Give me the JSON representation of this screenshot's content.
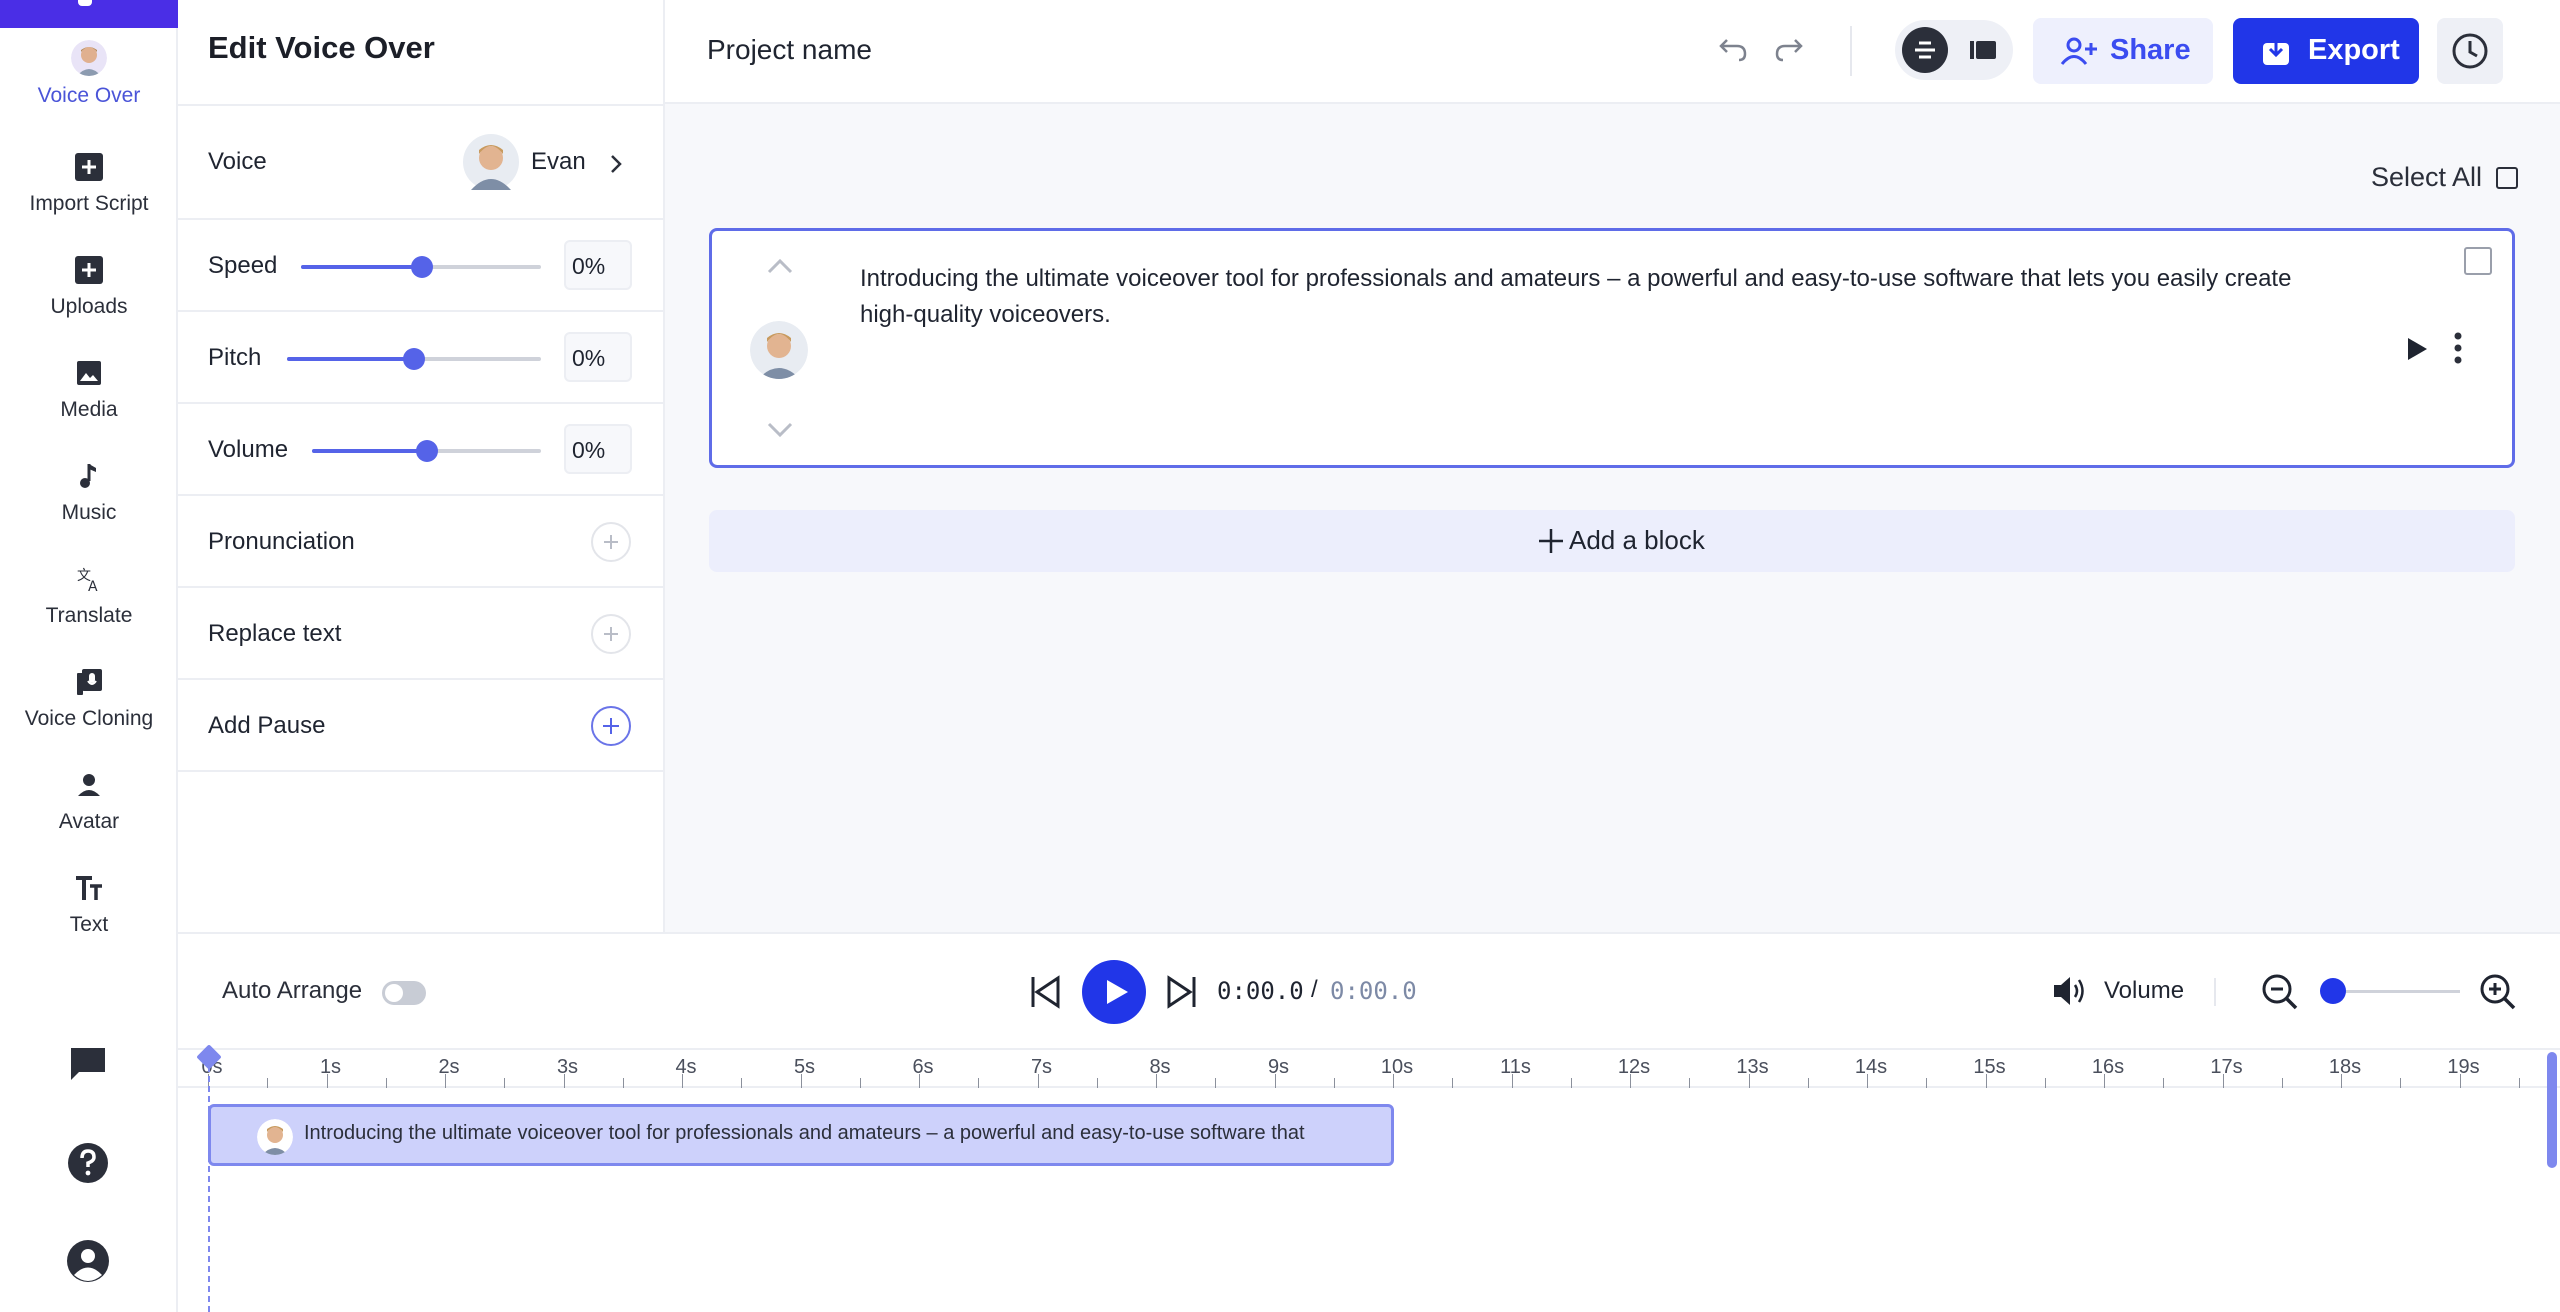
{
  "nav": {
    "items": [
      {
        "label": "Voice Over",
        "icon": "voice-over-avatar-icon"
      },
      {
        "label": "Import Script",
        "icon": "plus-square-icon"
      },
      {
        "label": "Uploads",
        "icon": "plus-square-icon"
      },
      {
        "label": "Media",
        "icon": "image-icon"
      },
      {
        "label": "Music",
        "icon": "music-note-icon"
      },
      {
        "label": "Translate",
        "icon": "translate-icon"
      },
      {
        "label": "Voice Cloning",
        "icon": "voice-cloning-icon"
      },
      {
        "label": "Avatar",
        "icon": "person-icon"
      },
      {
        "label": "Text",
        "icon": "text-size-icon"
      }
    ],
    "bottom_icons": [
      "chat-icon",
      "help-icon",
      "account-icon"
    ]
  },
  "edit_panel": {
    "title": "Edit Voice Over",
    "voice": {
      "label": "Voice",
      "name": "Evan"
    },
    "speed": {
      "label": "Speed",
      "value": "0%",
      "level": 0.5
    },
    "pitch": {
      "label": "Pitch",
      "value": "0%",
      "level": 0.5
    },
    "volume": {
      "label": "Volume",
      "value": "0%",
      "level": 0.5
    },
    "pronunciation": {
      "label": "Pronunciation"
    },
    "replace_text": {
      "label": "Replace text"
    },
    "add_pause": {
      "label": "Add Pause"
    }
  },
  "header": {
    "project_name": "Project name",
    "share_label": "Share",
    "export_label": "Export"
  },
  "main": {
    "select_all_label": "Select All",
    "block_text": "Introducing the ultimate voiceover tool for professionals and amateurs – a powerful and easy-to-use software that lets you easily create high-quality voiceovers.",
    "add_block_label": "Add a block"
  },
  "player": {
    "auto_arrange_label": "Auto Arrange",
    "auto_arrange_on": false,
    "current_time": "0:00.0",
    "separator": "/",
    "total_time": "0:00.0",
    "volume_label": "Volume",
    "zoom_level": 0
  },
  "timeline": {
    "ticks": [
      "0s",
      "1s",
      "2s",
      "3s",
      "4s",
      "5s",
      "6s",
      "7s",
      "8s",
      "9s",
      "10s",
      "11s",
      "12s",
      "13s",
      "14s",
      "15s",
      "16s",
      "17s",
      "18s",
      "19s"
    ],
    "clip_text": "Introducing the ultimate voiceover tool for professionals and amateurs – a powerful and easy-to-use software that"
  },
  "colors": {
    "accent": "#2136e8",
    "brand_purple": "#4a2ee6",
    "selection_border": "#5f6ce8",
    "clip_fill": "#cdd1fb"
  }
}
